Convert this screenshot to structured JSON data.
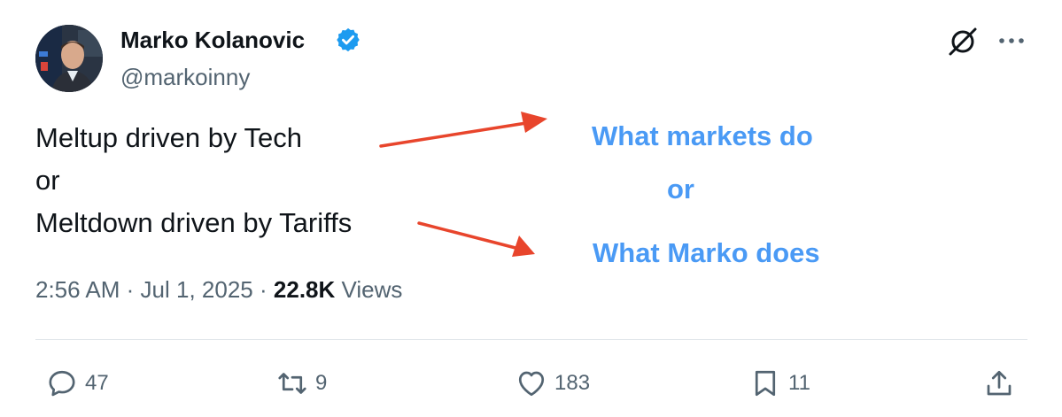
{
  "author": {
    "name": "Marko Kolanovic",
    "handle": "@markoinny",
    "avatar": "avatar-photo",
    "verified_icon": "verified-badge-icon",
    "verified_color": "#1d9bf0"
  },
  "tweet": {
    "lines": [
      "Meltup driven by Tech",
      "or",
      "Meltdown driven by Tariffs"
    ]
  },
  "annotations": {
    "top": "What markets do",
    "middle": "or",
    "bottom": "What Marko does",
    "text_color": "#4a9af5",
    "arrow_color": "#e8452c"
  },
  "meta": {
    "time": "2:56 AM",
    "sep1": "·",
    "date": "Jul 1, 2025",
    "sep2": "·",
    "views_count": "22.8K",
    "views_label": "Views"
  },
  "actions": {
    "replies": "47",
    "reposts": "9",
    "likes": "183",
    "bookmarks": "11"
  },
  "icons": {
    "grok": "grok-icon",
    "more": "more-icon",
    "reply": "reply-icon",
    "repost": "repost-icon",
    "like": "heart-icon",
    "bookmark": "bookmark-icon",
    "share": "share-icon"
  }
}
